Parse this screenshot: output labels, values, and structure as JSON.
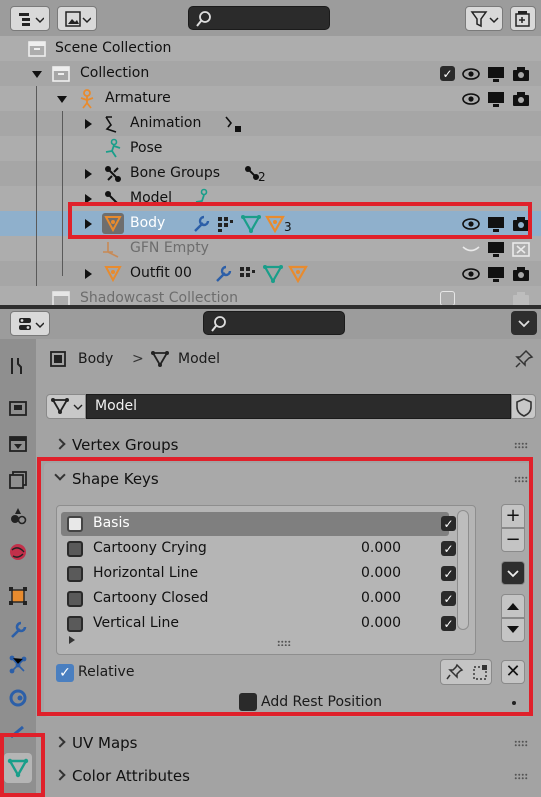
{
  "outliner": {
    "rows": {
      "scene": "Scene Collection",
      "collection": "Collection",
      "armature": "Armature",
      "animation": "Animation",
      "pose": "Pose",
      "bone_groups": "Bone Groups",
      "bone_groups_count": "2",
      "model": "Model",
      "body": "Body",
      "body_count": "3",
      "gfn_empty": "GFN Empty",
      "outfit": "Outfit 00",
      "shadowcast": "Shadowcast Collection"
    }
  },
  "properties": {
    "breadcrumb": {
      "object": "Body",
      "separator": ">",
      "data": "Model"
    },
    "datablock_name": "Model",
    "panels": {
      "vertex_groups": "Vertex Groups",
      "shape_keys": "Shape Keys",
      "uv_maps": "UV Maps",
      "color_attributes": "Color Attributes"
    },
    "shape_keys": [
      {
        "name": "Basis",
        "value": ""
      },
      {
        "name": "Cartoony Crying",
        "value": "0.000"
      },
      {
        "name": "Horizontal Line",
        "value": "0.000"
      },
      {
        "name": "Cartoony Closed",
        "value": "0.000"
      },
      {
        "name": "Vertical Line",
        "value": "0.000"
      }
    ],
    "relative_label": "Relative",
    "add_rest_label": "Add Rest Position",
    "add_btn": "+",
    "remove_btn": "−",
    "clear_btn": "✕"
  },
  "colors": {
    "highlight": "#e0202a",
    "selected_row": "#8fb0cc",
    "accent": "#4a7fc0"
  }
}
